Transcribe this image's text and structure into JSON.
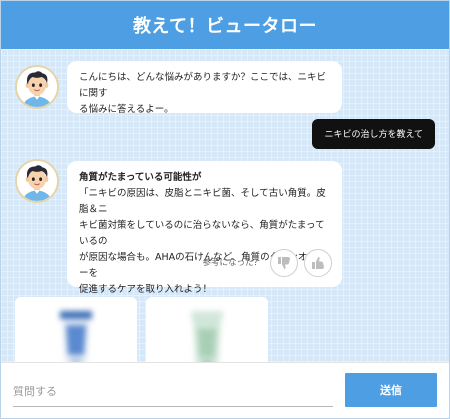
{
  "header": {
    "title": "教えて！ビュータロー"
  },
  "messages": {
    "bot_greeting": {
      "line1": "こんにちは、どんな悩みがありますか？ここでは、ニキビに関す",
      "line2": "る悩みに答えるよー。"
    },
    "user_question": "ニキビの治し方を教えて",
    "bot_answer": {
      "title": "角質がたまっている可能性が",
      "line1": "「ニキビの原因は、皮脂とニキビ菌、そして古い角質。皮脂＆ニ",
      "line2": "キビ菌対策をしているのに治らないなら、角質がたまっているの",
      "line3": "が原因な場合も。AHAの石けんなど、角質のターンオーバーを",
      "line4": "促進するケアを取り入れよう！",
      "feedback_label": "参考になった？"
    }
  },
  "icons": {
    "avatar": "avatar-boy-icon",
    "thumbs_down": "thumbs-down-icon",
    "thumbs_up": "thumbs-up-icon"
  },
  "products": [
    {
      "name": "product-tube-blue"
    },
    {
      "name": "product-tube-green"
    }
  ],
  "input": {
    "placeholder": "質問する",
    "send_label": "送信"
  },
  "colors": {
    "header": "#4d9ee3",
    "background": "#d6e8f7",
    "send_button": "#4d9ee3",
    "user_bubble": "#111111"
  }
}
